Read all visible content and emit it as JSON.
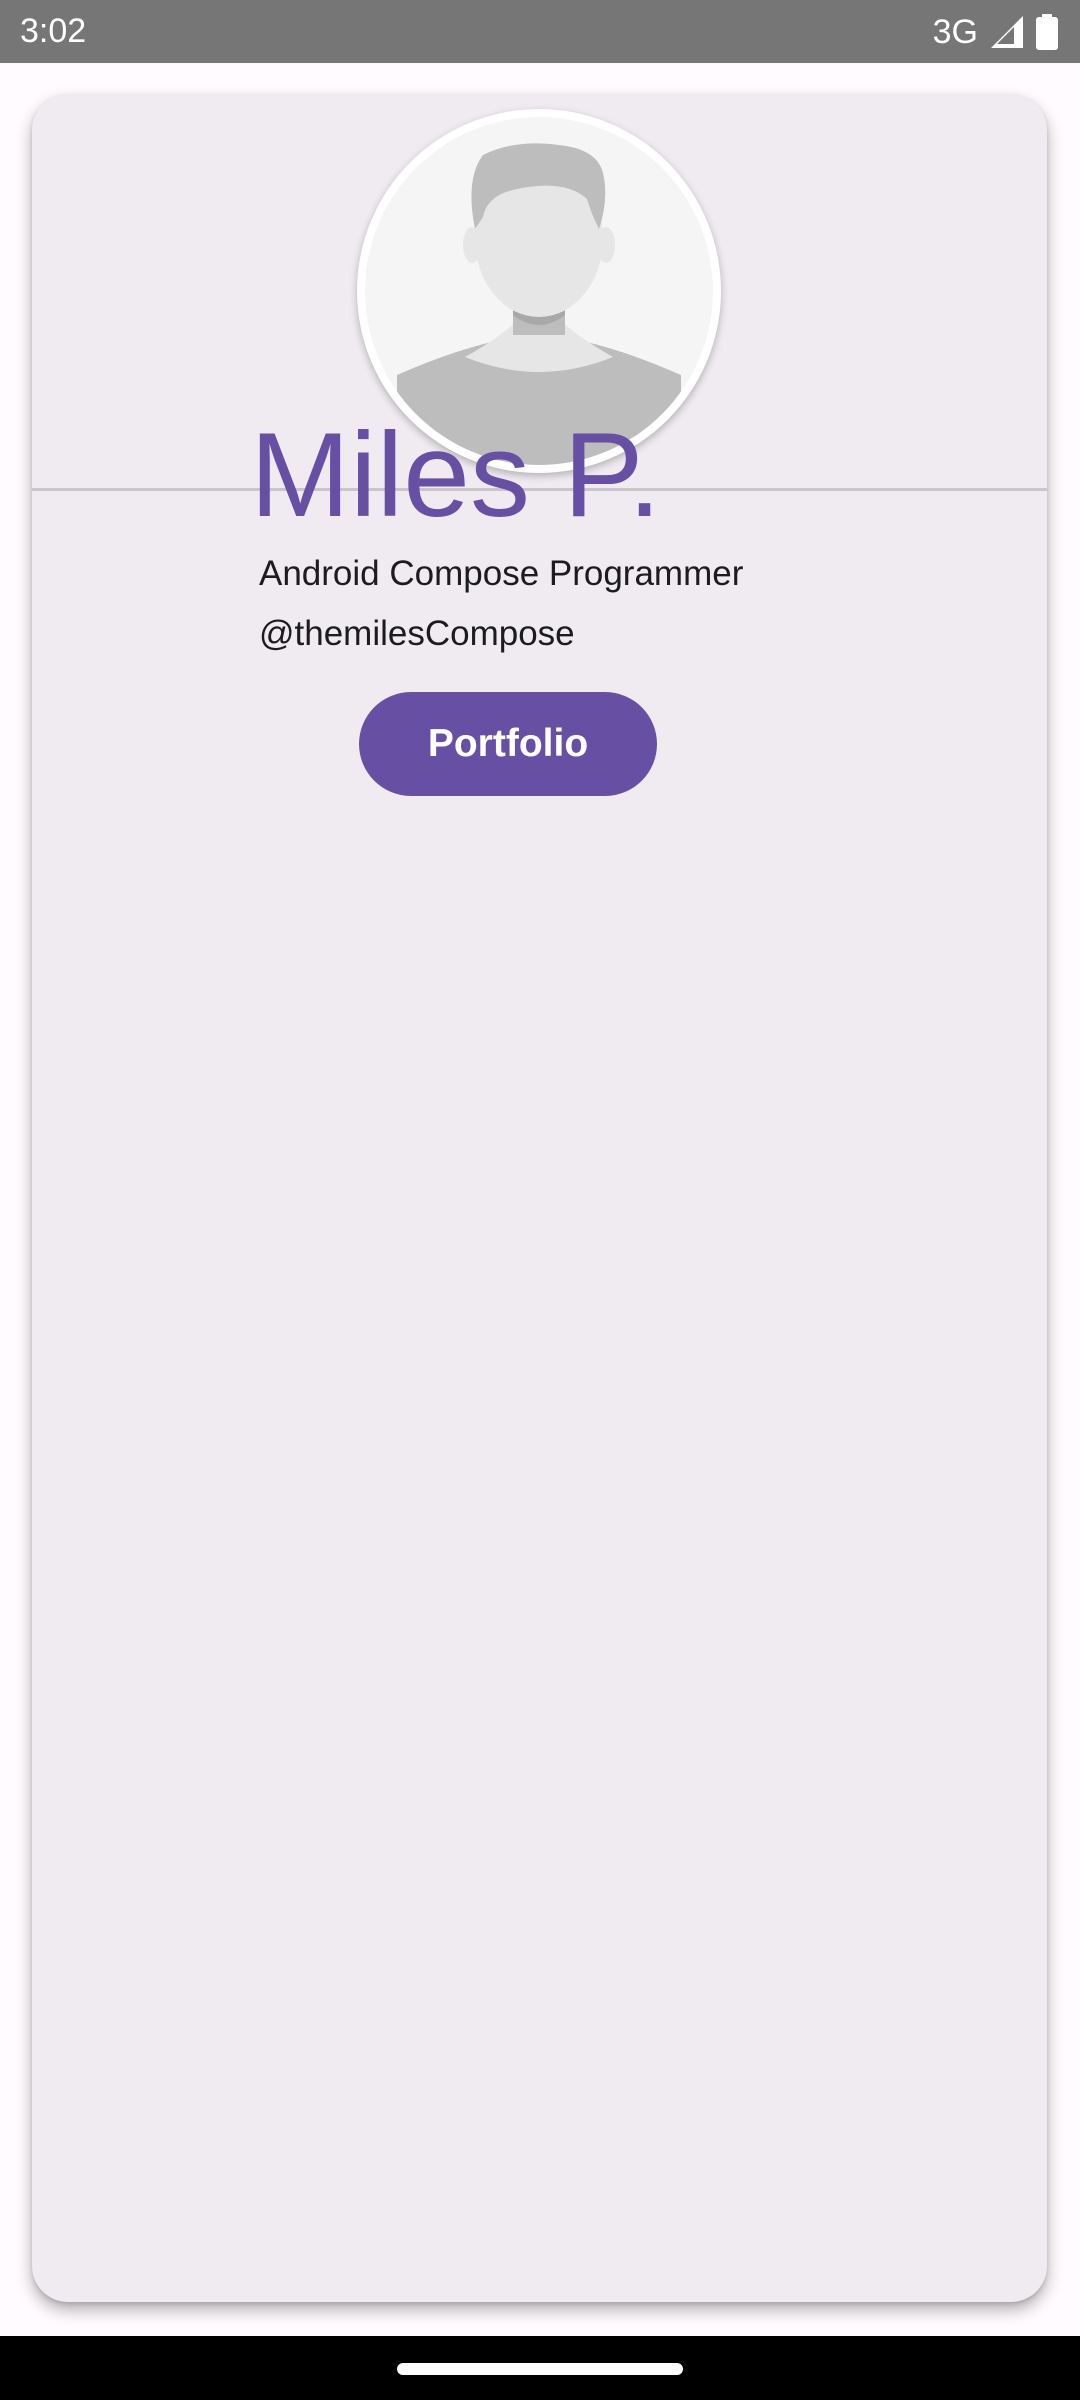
{
  "status_bar": {
    "time": "3:02",
    "network": "3G",
    "icons": [
      "signal-icon",
      "battery-icon"
    ],
    "background_color": "#767676"
  },
  "profile": {
    "avatar_icon": "person-placeholder-icon",
    "name": "Miles P.",
    "title": "Android Compose Programmer",
    "handle": "@themilesCompose",
    "button_label": "Portfolio"
  },
  "colors": {
    "accent": "#6750a4",
    "card_background": "#efebf0",
    "page_background": "#fffbfe",
    "text": "#1c1b1f"
  },
  "navigation_bar": {
    "icon": "home-handle"
  }
}
